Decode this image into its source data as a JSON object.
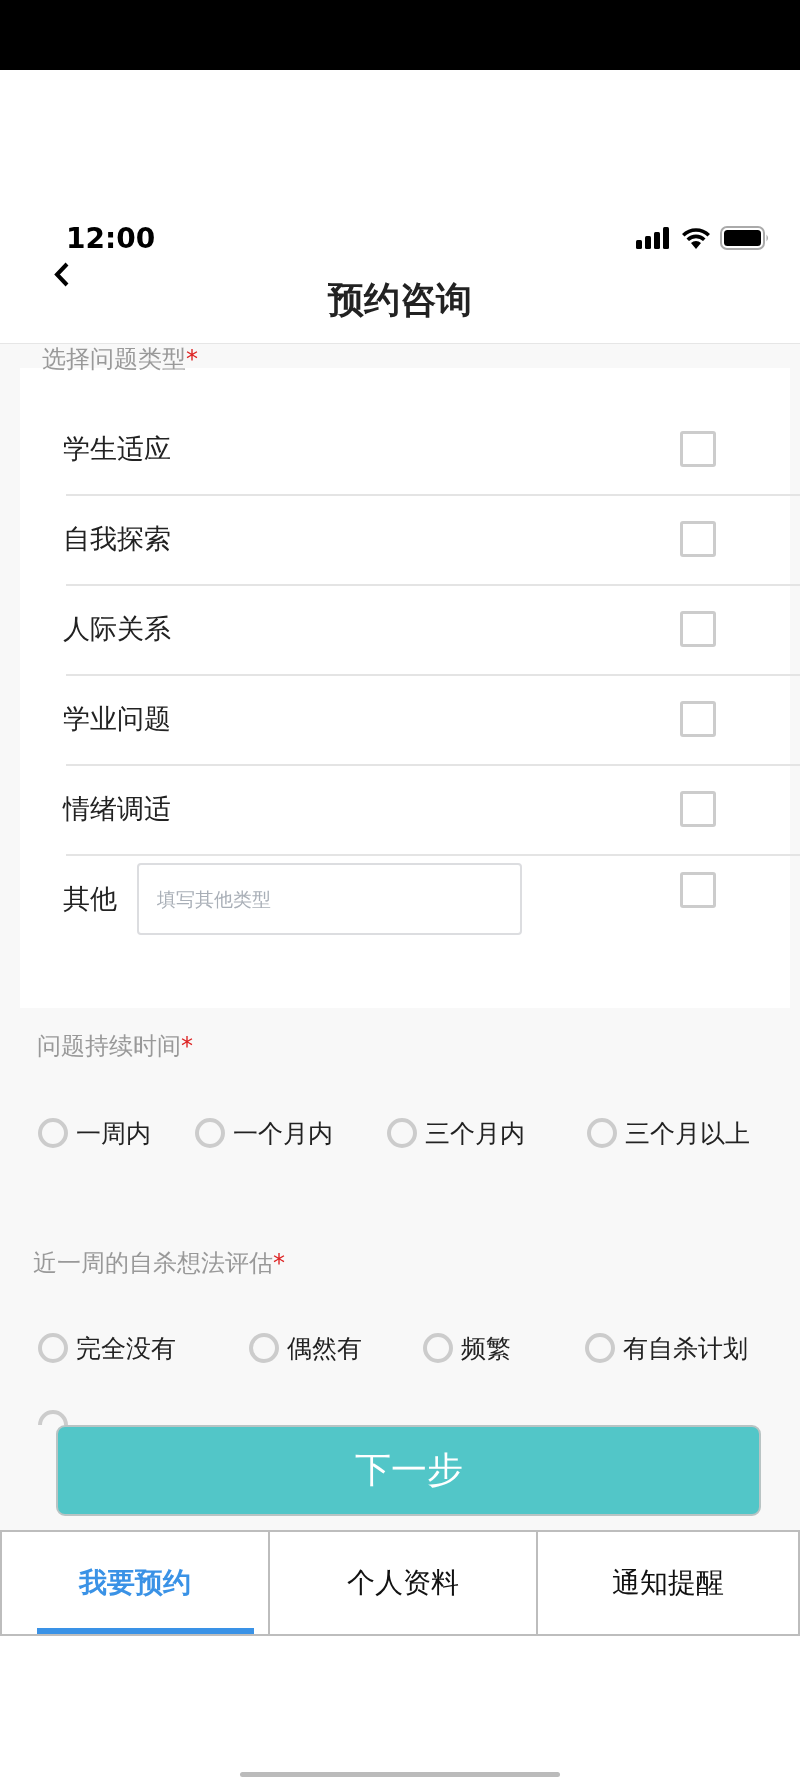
{
  "status_bar": {
    "time": "12:00"
  },
  "nav": {
    "title": "预约咨询"
  },
  "problem_type": {
    "label": "选择问题类型",
    "required": "*",
    "options": [
      {
        "label": "学生适应",
        "checked": false
      },
      {
        "label": "自我探索",
        "checked": false
      },
      {
        "label": "人际关系",
        "checked": false
      },
      {
        "label": "学业问题",
        "checked": false
      },
      {
        "label": "情绪调适",
        "checked": false
      },
      {
        "label": "其他",
        "checked": false,
        "kind": "other",
        "placeholder": "填写其他类型"
      }
    ]
  },
  "duration": {
    "label": "问题持续时间",
    "required": "*",
    "options": [
      {
        "label": "一周内",
        "selected": false
      },
      {
        "label": "一个月内",
        "selected": false
      },
      {
        "label": "三个月内",
        "selected": false
      },
      {
        "label": "三个月以上",
        "selected": false
      }
    ]
  },
  "suicide_assessment": {
    "label": "近一周的自杀想法评估",
    "required": "*",
    "options": [
      {
        "label": "完全没有",
        "selected": false
      },
      {
        "label": "偶然有",
        "selected": false
      },
      {
        "label": "频繁",
        "selected": false
      },
      {
        "label": "有自杀计划",
        "selected": false
      },
      {
        "selected": false
      }
    ]
  },
  "next_button": "下一步",
  "tabs": [
    {
      "label": "我要预约",
      "selected": true
    },
    {
      "label": "个人资料",
      "selected": false
    },
    {
      "label": "通知提醒",
      "selected": false
    }
  ]
}
